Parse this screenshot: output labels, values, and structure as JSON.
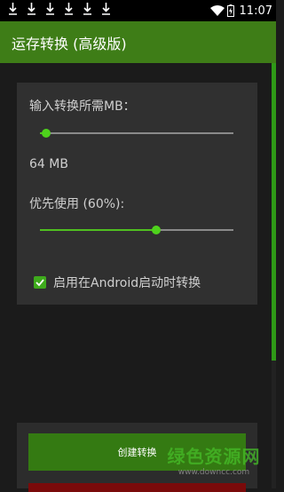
{
  "statusbar": {
    "icons": [
      "download-icon",
      "download-icon",
      "download-icon",
      "download-icon",
      "download-icon",
      "download-icon"
    ],
    "time": "11:07"
  },
  "appbar": {
    "title": "运存转换 (高级版)"
  },
  "settings": {
    "mb_label": "输入转换所需MB：",
    "mb_slider_fraction": 0.03,
    "mb_value": "64 MB",
    "priority_label": "优先使用 (60%):",
    "priority_fraction": 0.6,
    "startup_label": "启用在Android启动时转换",
    "startup_checked": true
  },
  "actions": {
    "create_label": "创建转换"
  },
  "watermark": {
    "text": "绿色资源网",
    "url": "www.downcc.com"
  },
  "colors": {
    "accent": "#3e7d17",
    "thumb": "#4ed21c",
    "danger": "#7a0a0a"
  }
}
